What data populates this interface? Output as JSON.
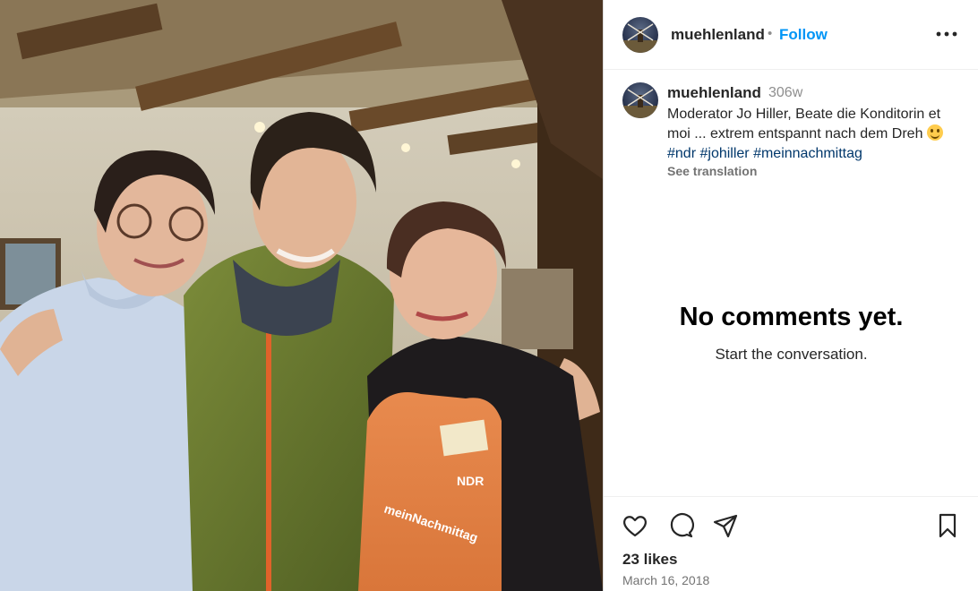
{
  "post": {
    "username": "muehlenland",
    "follow_label": "Follow",
    "separator": "•",
    "more_icon": "more-horizontal-icon"
  },
  "caption": {
    "username": "muehlenland",
    "time": "306w",
    "text_before": "Moderator Jo Hiller, Beate die Konditorin et moi ... extrem entspannt nach dem Dreh ",
    "emoji": "smiling-face-emoji",
    "hashtags": [
      "#ndr",
      "#johiller",
      "#meinnachmittag"
    ],
    "see_translation": "See translation"
  },
  "comments": {
    "empty_title": "No comments yet.",
    "empty_subtitle": "Start the conversation."
  },
  "actions": {
    "like_icon": "heart-icon",
    "comment_icon": "comment-icon",
    "share_icon": "share-icon",
    "save_icon": "bookmark-icon",
    "likes": "23 likes",
    "date": "March 16, 2018"
  },
  "photo": {
    "apron_brand": "NDR",
    "apron_text": "meinNachmittag"
  },
  "colors": {
    "accent": "#0095f6",
    "hashtag": "#00376b",
    "muted": "#8e8e8e",
    "text": "#262626"
  }
}
